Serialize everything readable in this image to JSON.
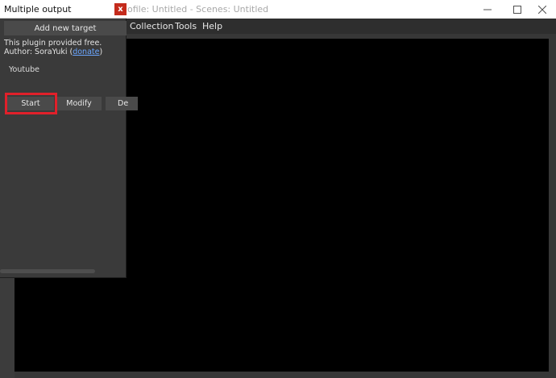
{
  "main_window": {
    "title": "ofile: Untitled - Scenes: Untitled",
    "controls": {
      "minimize": "minimize-icon",
      "maximize": "maximize-icon",
      "close": "close-icon"
    }
  },
  "menu": {
    "items": [
      "Collection",
      "Tools",
      "Help"
    ]
  },
  "dialog": {
    "title": "Multiple output",
    "close_label": "x",
    "add_target_label": "Add new target",
    "info_line1": "This plugin provided free.",
    "info_prefix": "Author: SoraYuki (",
    "donate_label": "donate",
    "info_suffix": ")",
    "target_name": "Youtube",
    "start_label": "Start",
    "modify_label": "Modify",
    "delete_label": "De"
  },
  "colors": {
    "highlight": "#e0202a",
    "preview": "#000000",
    "dialog_close": "#c42b1c",
    "link": "#6aa6ff"
  }
}
